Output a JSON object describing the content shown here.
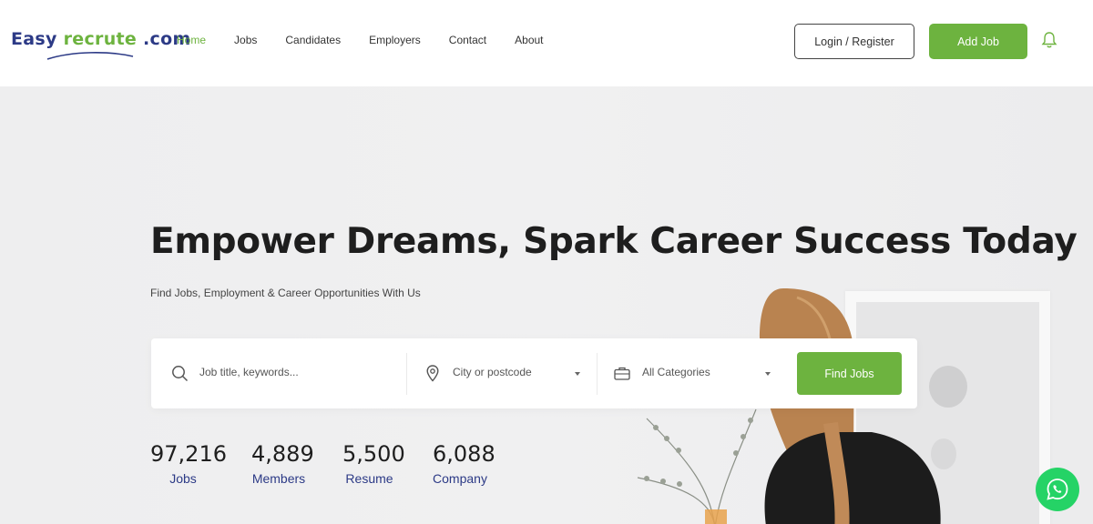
{
  "logo": {
    "easy": "Easy",
    "recrute": "recrute",
    "com": ".com"
  },
  "nav": {
    "items": [
      {
        "label": "Home",
        "active": true
      },
      {
        "label": "Jobs"
      },
      {
        "label": "Candidates"
      },
      {
        "label": "Employers"
      },
      {
        "label": "Contact"
      },
      {
        "label": "About"
      }
    ]
  },
  "header": {
    "login_label": "Login / Register",
    "add_job_label": "Add Job",
    "notification_icon": "bell-icon"
  },
  "hero": {
    "title": "Empower Dreams, Spark Career Success Today",
    "subtitle": "Find Jobs, Employment & Career Opportunities With Us"
  },
  "search": {
    "keywords_placeholder": "Job title, keywords...",
    "location_value": "City or postcode",
    "category_value": "All Categories",
    "find_label": "Find Jobs"
  },
  "stats": [
    {
      "value": "97,216",
      "label": "Jobs"
    },
    {
      "value": "4,889",
      "label": "Members"
    },
    {
      "value": "5,500",
      "label": "Resume"
    },
    {
      "value": "6,088",
      "label": "Company"
    }
  ],
  "colors": {
    "brand_green": "#6db33f",
    "brand_navy": "#2c3a86",
    "whatsapp_green": "#25d366"
  }
}
